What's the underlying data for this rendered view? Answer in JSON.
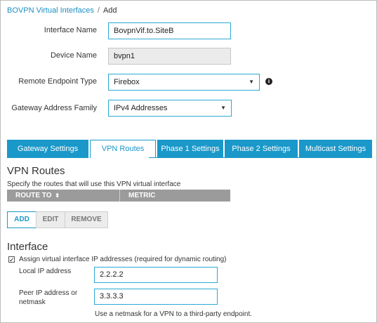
{
  "breadcrumb": {
    "parent": "BOVPN Virtual Interfaces",
    "separator": "/",
    "current": "Add"
  },
  "form": {
    "interface_name": {
      "label": "Interface Name",
      "value": "BovpnVif.to.SiteB"
    },
    "device_name": {
      "label": "Device Name",
      "value": "bvpn1"
    },
    "remote_endpoint_type": {
      "label": "Remote Endpoint Type",
      "value": "Firebox",
      "info_icon": "info-icon"
    },
    "gateway_address_family": {
      "label": "Gateway Address Family",
      "value": "IPv4 Addresses"
    }
  },
  "tabs": [
    {
      "label": "Gateway Settings",
      "active": false
    },
    {
      "label": "VPN Routes",
      "active": true
    },
    {
      "label": "Phase 1 Settings",
      "active": false
    },
    {
      "label": "Phase 2 Settings",
      "active": false
    },
    {
      "label": "Multicast Settings",
      "active": false
    }
  ],
  "vpn_routes": {
    "title": "VPN Routes",
    "description": "Specify the routes that will use this VPN virtual interface",
    "columns": [
      "ROUTE TO",
      "METRIC"
    ],
    "sort_icon": "sort-icon",
    "buttons": {
      "add": "ADD",
      "edit": "EDIT",
      "remove": "REMOVE"
    }
  },
  "interface": {
    "title": "Interface",
    "assign_checkbox": {
      "label": "Assign virtual interface IP addresses (required for dynamic routing)",
      "checked": true,
      "mark": "✓"
    },
    "local_ip": {
      "label": "Local IP address",
      "value": "2.2.2.2"
    },
    "peer_ip": {
      "label_line1": "Peer IP address or",
      "label_line2": "netmask",
      "value": "3.3.3.3"
    },
    "hint": "Use a netmask for a VPN to a third-party endpoint."
  },
  "colors": {
    "accent": "#1a98c9",
    "link": "#1c8fc4",
    "table_header": "#9b9b9b"
  }
}
